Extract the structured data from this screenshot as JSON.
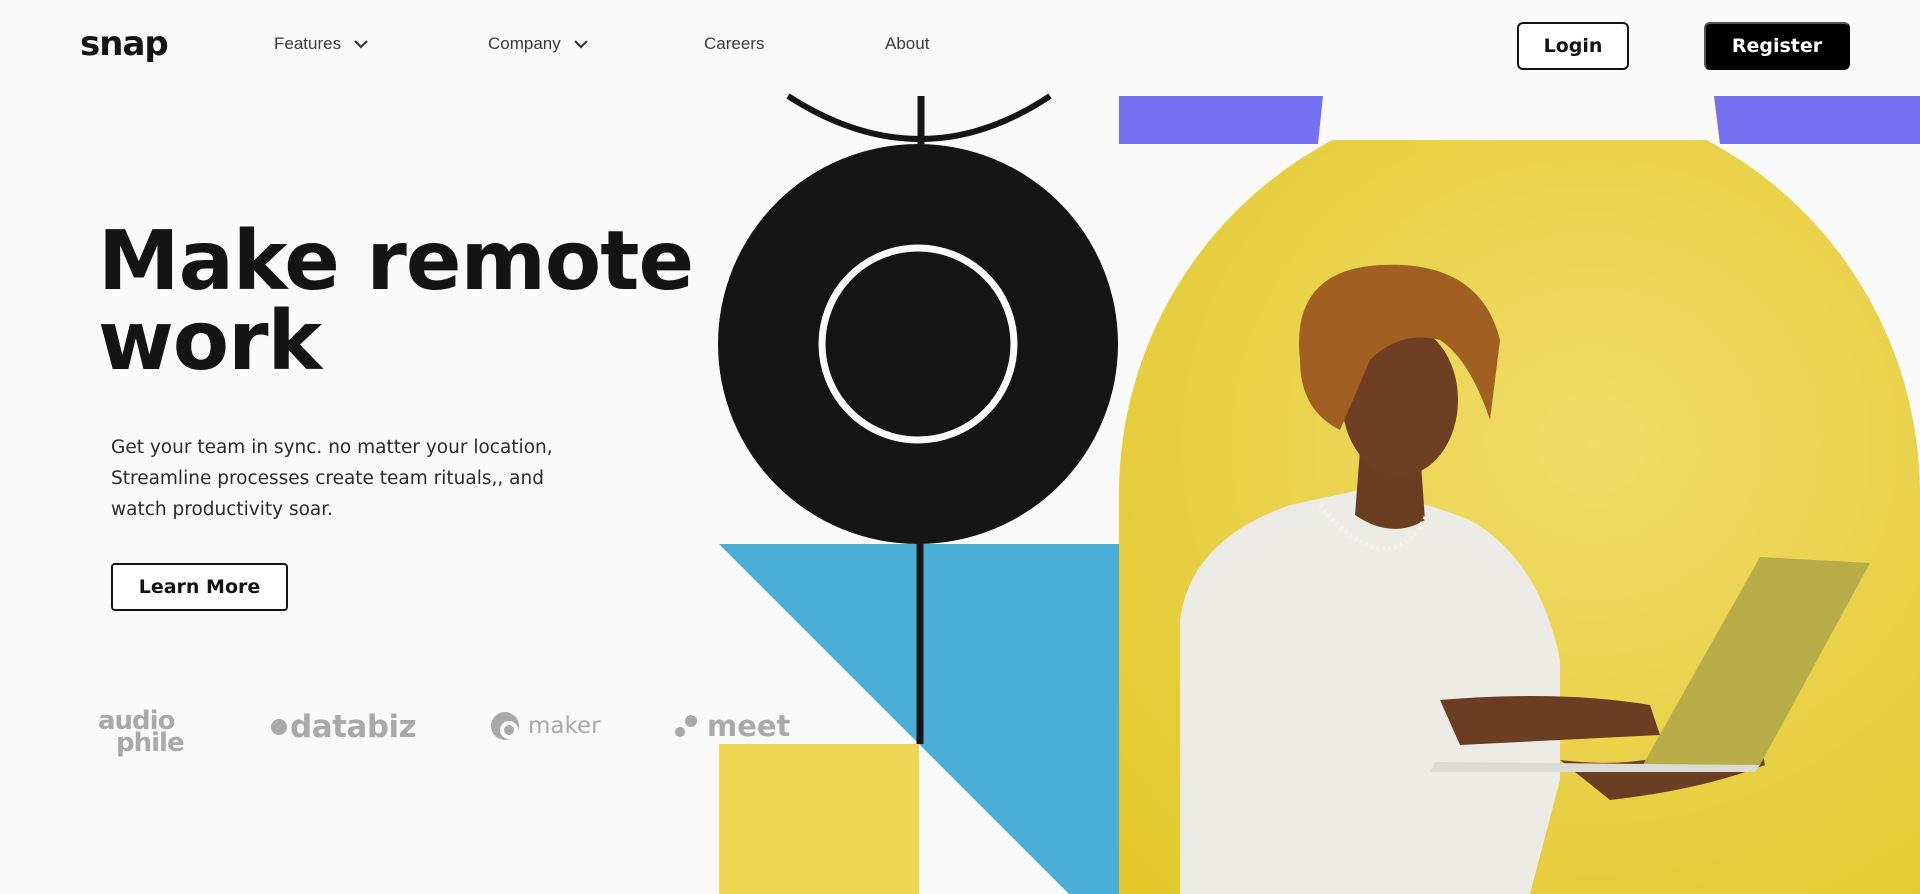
{
  "header": {
    "logo": "snap",
    "nav": [
      {
        "label": "Features",
        "has_dropdown": true
      },
      {
        "label": "Company",
        "has_dropdown": true
      },
      {
        "label": "Careers",
        "has_dropdown": false
      },
      {
        "label": "About",
        "has_dropdown": false
      }
    ],
    "login_label": "Login",
    "register_label": "Register"
  },
  "hero": {
    "title_line1": "Make remote",
    "title_line2": "work",
    "subtitle_lines": [
      "Get your team in sync. no matter your location,",
      "Streamline processes create team rituals,, and",
      "watch productivity soar."
    ],
    "cta_label": "Learn More"
  },
  "clients": {
    "audiophile_l1": "audio",
    "audiophile_l2": "phile",
    "databiz": "databiz",
    "maker": "maker",
    "meet": "meet"
  },
  "colors": {
    "background": "#fafafa",
    "text_dark": "#141414",
    "client_gray": "#a9a9a9",
    "purple": "#7570ef",
    "blue": "#4aaed9",
    "yellow": "#ecd653",
    "black_shape": "#151515"
  },
  "icons": {
    "nav_dropdown": "chevron-down-icon"
  }
}
